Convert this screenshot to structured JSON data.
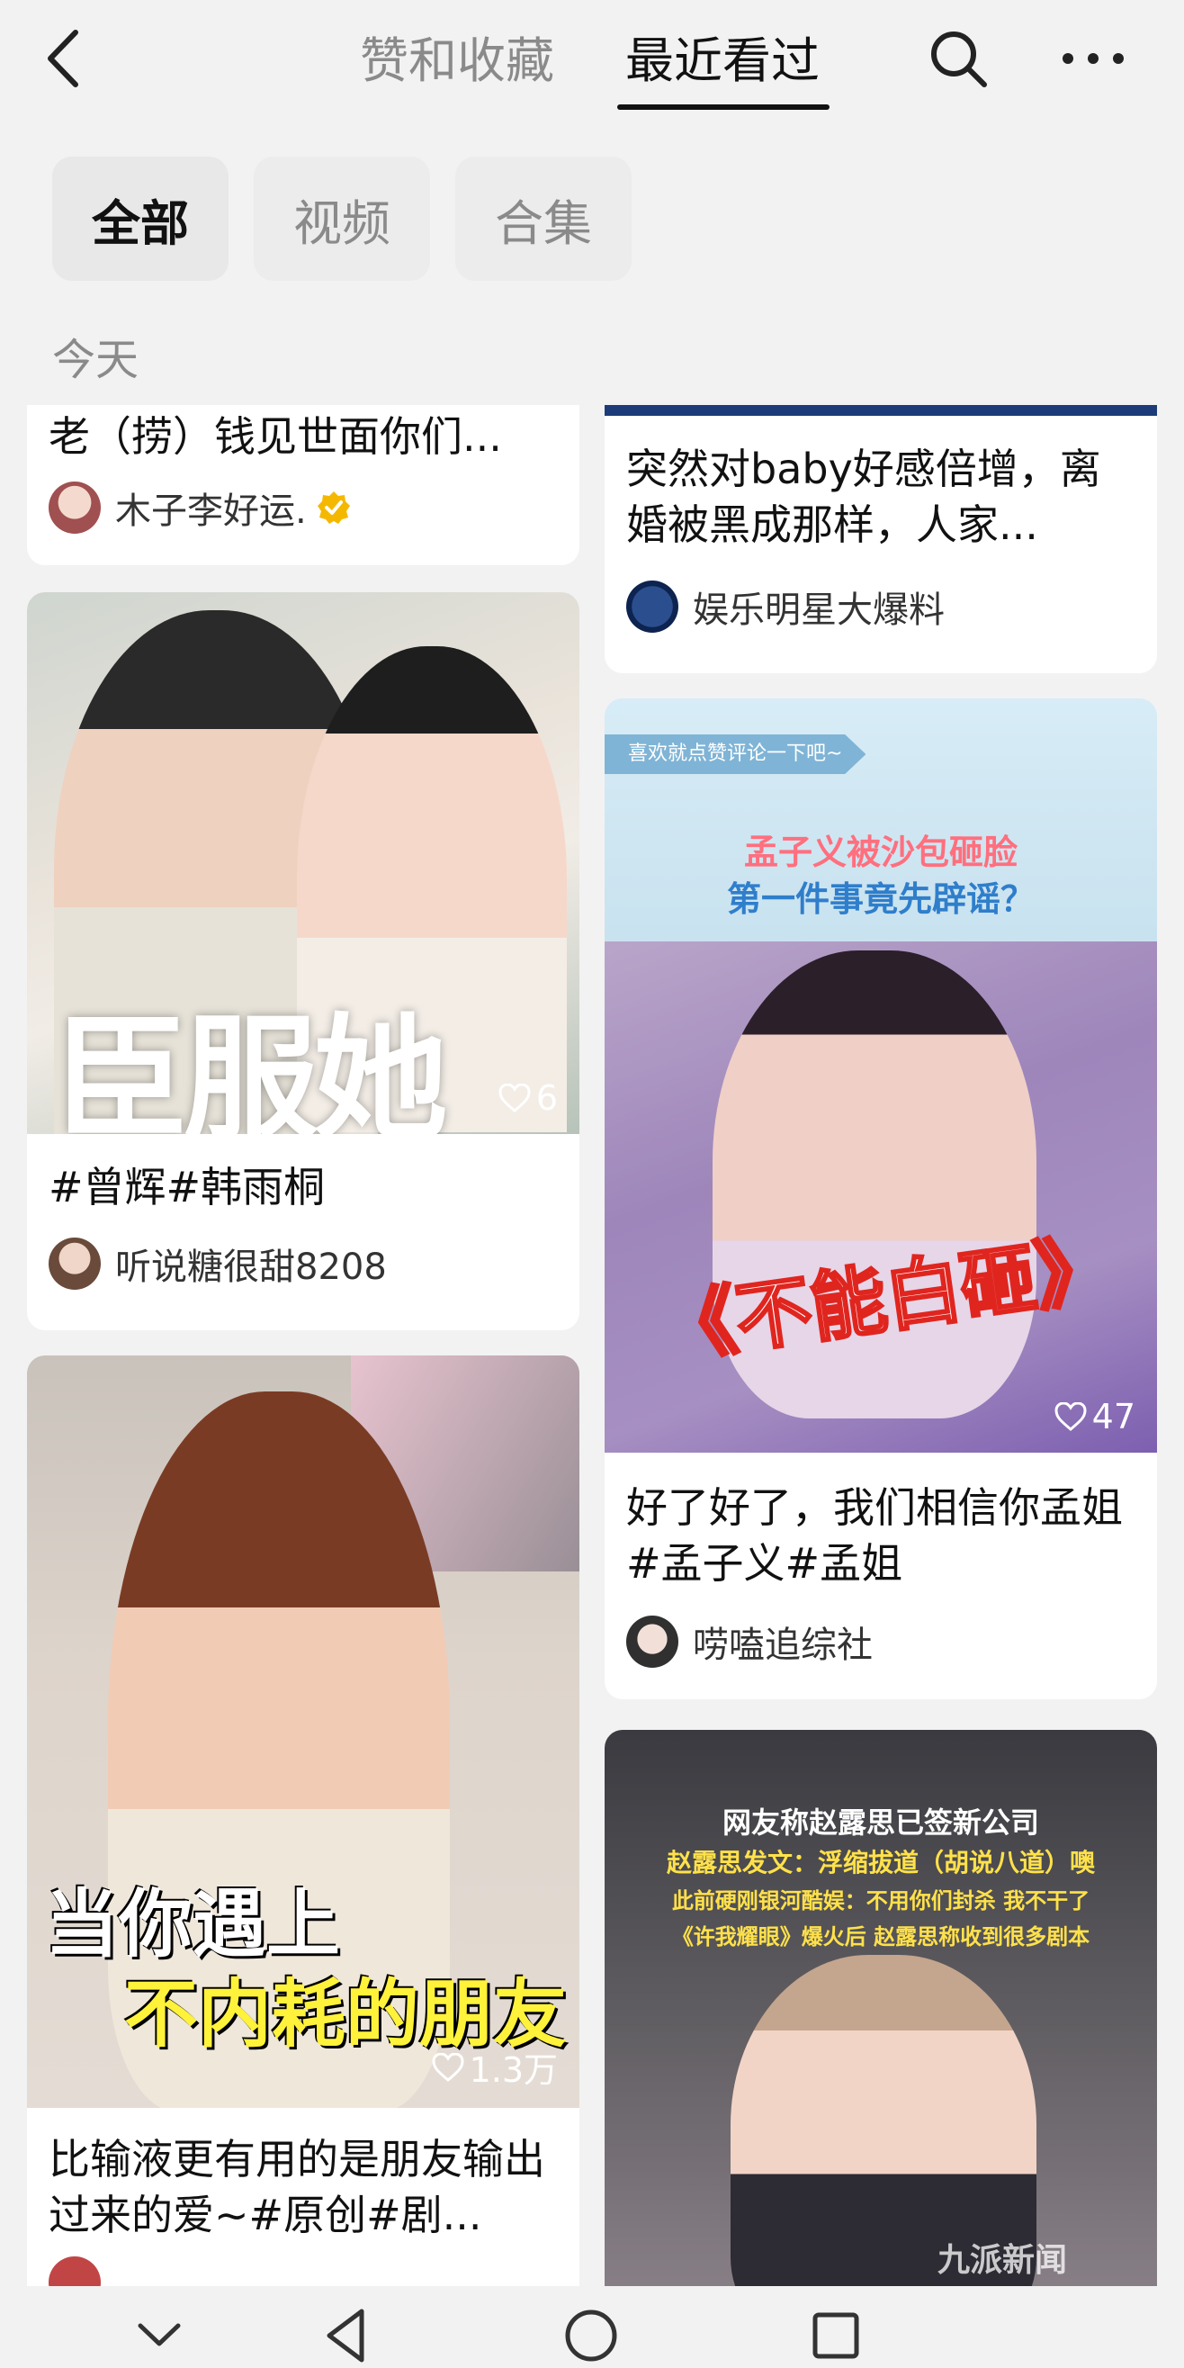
{
  "header": {
    "tab_inactive": "赞和收藏",
    "tab_active": "最近看过",
    "back_icon": "chevron-left-icon",
    "search_icon": "search-icon",
    "more_icon": "more-horizontal-icon"
  },
  "filters": [
    "全部",
    "视频",
    "合集"
  ],
  "section_label": "今天",
  "cards": {
    "c1": {
      "title": "老（捞）钱见世面你们...",
      "author": "木子李好运.",
      "verified": true
    },
    "c2": {
      "title": "#曾辉#韩雨桐",
      "author": "听说糖很甜8208",
      "likes": "6",
      "overlay": "臣服她"
    },
    "c3": {
      "title": "比输液更有用的是朋友输出过来的爱~#原创#剧...",
      "author": "",
      "likes": "1.3万",
      "overlay_line1": "当你遇上",
      "overlay_line2": "不内耗的朋友"
    },
    "c4": {
      "title": "突然对baby好感倍增，离婚被黑成那样，人家...",
      "author": "娱乐明星大爆料"
    },
    "c5": {
      "title": "好了好了，我们相信你孟姐#孟子义#孟姐",
      "author": "唠嗑追综社",
      "likes": "47",
      "banner": "喜欢就点赞评论一下吧~",
      "headline1": "孟子义被沙包砸脸",
      "headline2": "第一件事竟先辟谣？",
      "overlay": "《不能白砸》"
    },
    "c6": {
      "headline1": "网友称赵露思已签新公司",
      "headline2": "赵露思发文：浮缩拔道（胡说八道）噢",
      "headline3": "此前硬刚银河酷娱：不用你们封杀 我不干了",
      "headline4": "《许我耀眼》爆火后 赵露思称收到很多剧本",
      "watermark": "九派新闻"
    }
  },
  "colors": {
    "bg": "#f2f2f2",
    "card": "#ffffff",
    "verified": "#f5b800",
    "text": "#111111",
    "muted": "#8a8a8a"
  },
  "nav": {
    "icons": [
      "chevron-down-icon",
      "back-triangle-icon",
      "home-circle-icon",
      "recents-square-icon"
    ]
  }
}
